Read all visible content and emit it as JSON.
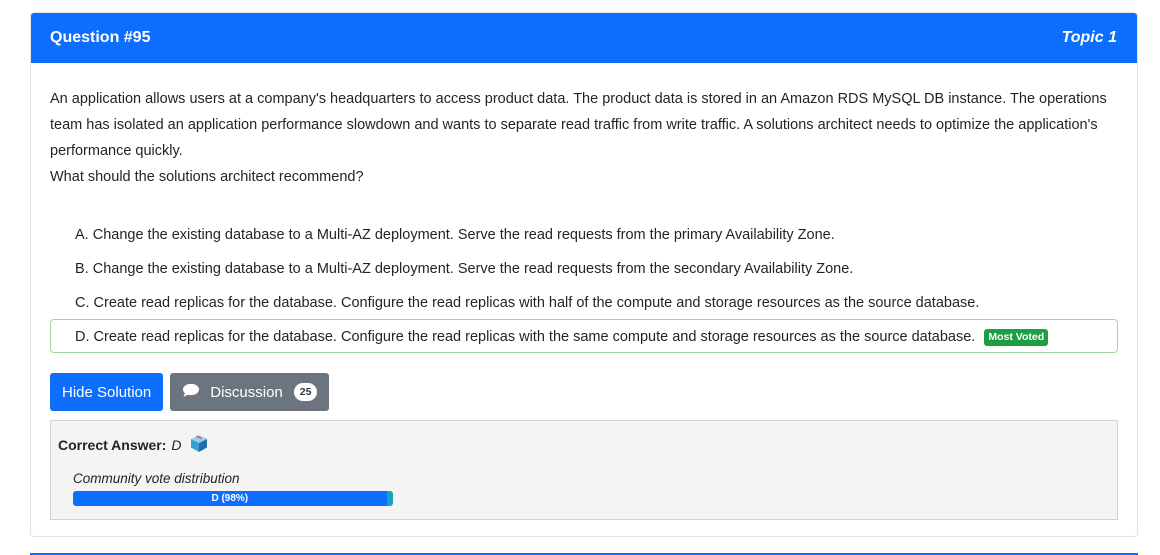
{
  "header": {
    "question_number": "Question #95",
    "topic": "Topic 1"
  },
  "question": {
    "paragraph": "An application allows users at a company's headquarters to access product data. The product data is stored in an Amazon RDS MySQL DB instance. The operations team has isolated an application performance slowdown and wants to separate read traffic from write traffic. A solutions architect needs to optimize the application's performance quickly.",
    "prompt": "What should the solutions architect recommend?"
  },
  "choices": [
    {
      "text": "A. Change the existing database to a Multi-AZ deployment. Serve the read requests from the primary Availability Zone."
    },
    {
      "text": "B. Change the existing database to a Multi-AZ deployment. Serve the read requests from the secondary Availability Zone."
    },
    {
      "text": "C. Create read replicas for the database. Configure the read replicas with half of the compute and storage resources as the source database."
    },
    {
      "text": "D. Create read replicas for the database. Configure the read replicas with the same compute and storage resources as the source database.",
      "badge": "Most Voted"
    }
  ],
  "buttons": {
    "hide_solution": "Hide Solution",
    "discussion": "Discussion",
    "discussion_count": "25"
  },
  "answer": {
    "label": "Correct Answer:",
    "value": "D",
    "vote_title": "Community vote distribution",
    "vote_label": "D (98%)",
    "vote_fraction": 0.98
  },
  "colors": {
    "primary": "#0d6efd",
    "secondary": "#6c757d",
    "success": "#1e9e43",
    "vote_rest": "#17a2b8"
  },
  "icons": [
    "comment-bubble-icon",
    "answer-cube-icon"
  ]
}
